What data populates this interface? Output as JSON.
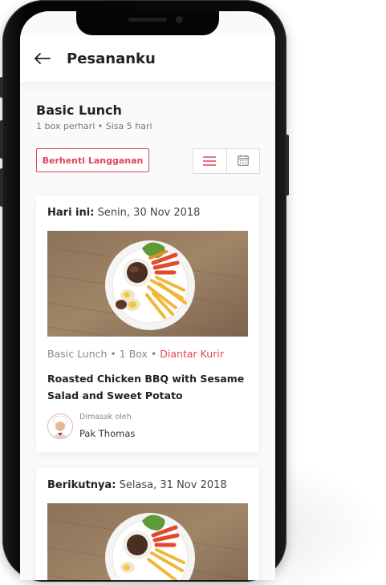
{
  "header": {
    "title": "Pesananku",
    "back_icon": "arrow-left-icon"
  },
  "plan": {
    "name": "Basic Lunch",
    "subtitle": "1 box perhari • Sisa 5 hari",
    "stop_label": "Berhenti Langganan",
    "view_icons": [
      "list-icon",
      "calendar-icon"
    ]
  },
  "orders": [
    {
      "day_label": "Hari ini:",
      "date": "Senin, 30 Nov 2018",
      "meta": "Basic Lunch • 1 Box • ",
      "status": "Diantar Kurir",
      "dish": "Roasted Chicken BBQ with Sesame Salad and Sweet Potato",
      "cooked_by_label": "Dimasak oleh",
      "chef": "Pak Thomas"
    },
    {
      "day_label": "Berikutnya:",
      "date": "Selasa, 31 Nov 2018"
    }
  ],
  "colors": {
    "accent": "#e04459",
    "text": "#222222",
    "muted": "#888888"
  }
}
